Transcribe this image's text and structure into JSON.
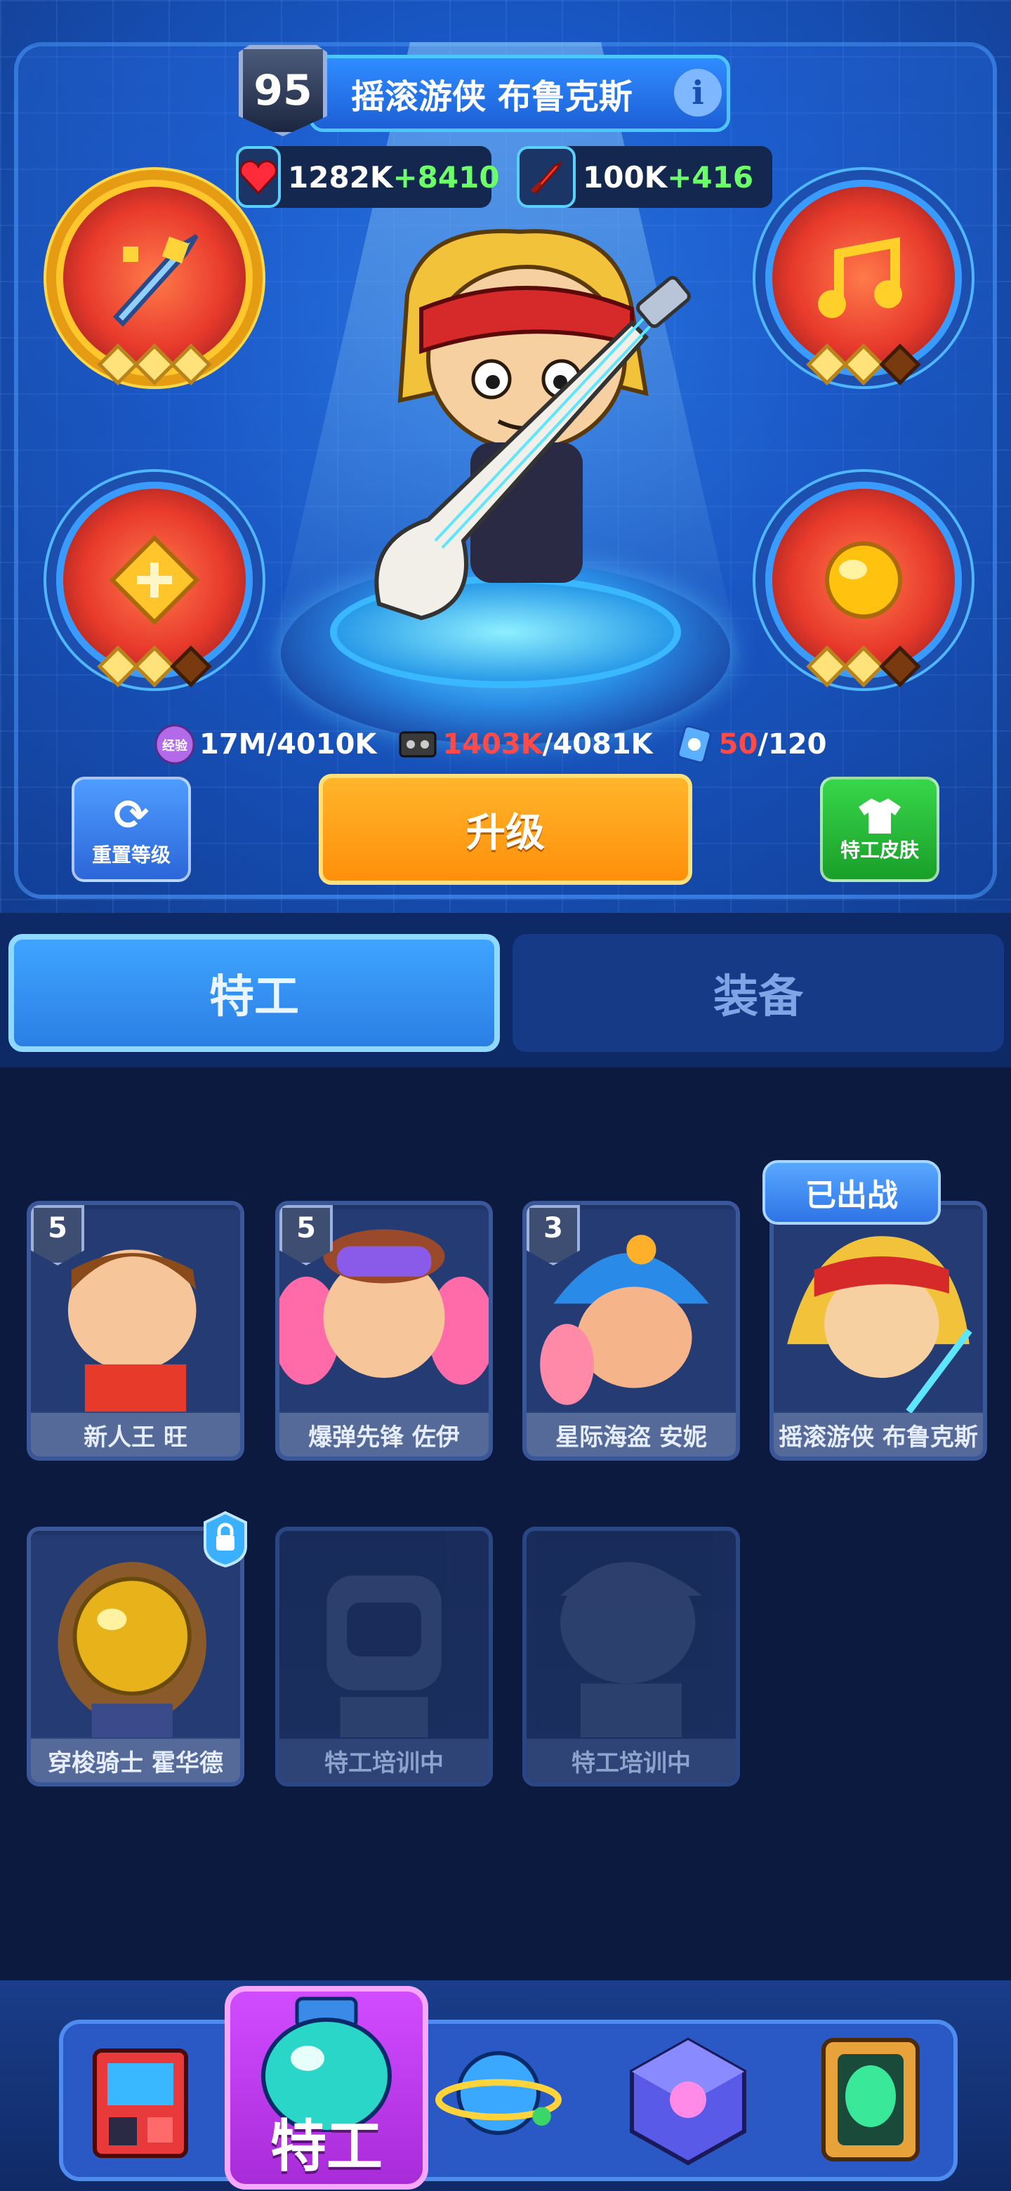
{
  "hero": {
    "level": "95",
    "name": "摇滚游侠 布鲁克斯",
    "hp": "1282K",
    "hp_bonus": "+8410",
    "atk": "100K",
    "atk_bonus": "+416"
  },
  "resources": {
    "exp_icon_label": "经验",
    "exp": "17M/4010K",
    "tape_have": "1403K",
    "tape_need": "/4081K",
    "card_have": "50",
    "card_need": "/120"
  },
  "buttons": {
    "reset": "重置等级",
    "upgrade": "升级",
    "skin": "特工皮肤"
  },
  "tabs": {
    "agent": "特工",
    "equipment": "装备"
  },
  "agents": [
    {
      "rank": "5",
      "name": "新人王 旺"
    },
    {
      "rank": "5",
      "name": "爆弹先锋 佐伊"
    },
    {
      "rank": "3",
      "name": "星际海盗 安妮"
    },
    {
      "rank": "",
      "name": "摇滚游侠 布鲁克斯"
    },
    {
      "rank": "",
      "name": "穿梭骑士 霍华德"
    },
    {
      "rank": "",
      "name": "特工培训中"
    },
    {
      "rank": "",
      "name": "特工培训中"
    }
  ],
  "deployed_badge": "已出战",
  "nav": {
    "active_label": "特工"
  },
  "colors": {
    "accent_blue": "#2b7fe4",
    "upgrade_orange": "#ff8f0b",
    "bonus_green": "#6dff6a",
    "insufficient_red": "#ff4a4a"
  },
  "icons": [
    "heart-icon",
    "sword-icon",
    "exp-icon",
    "tape-icon",
    "card-icon",
    "refresh-icon",
    "shirt-icon",
    "lock-icon"
  ]
}
